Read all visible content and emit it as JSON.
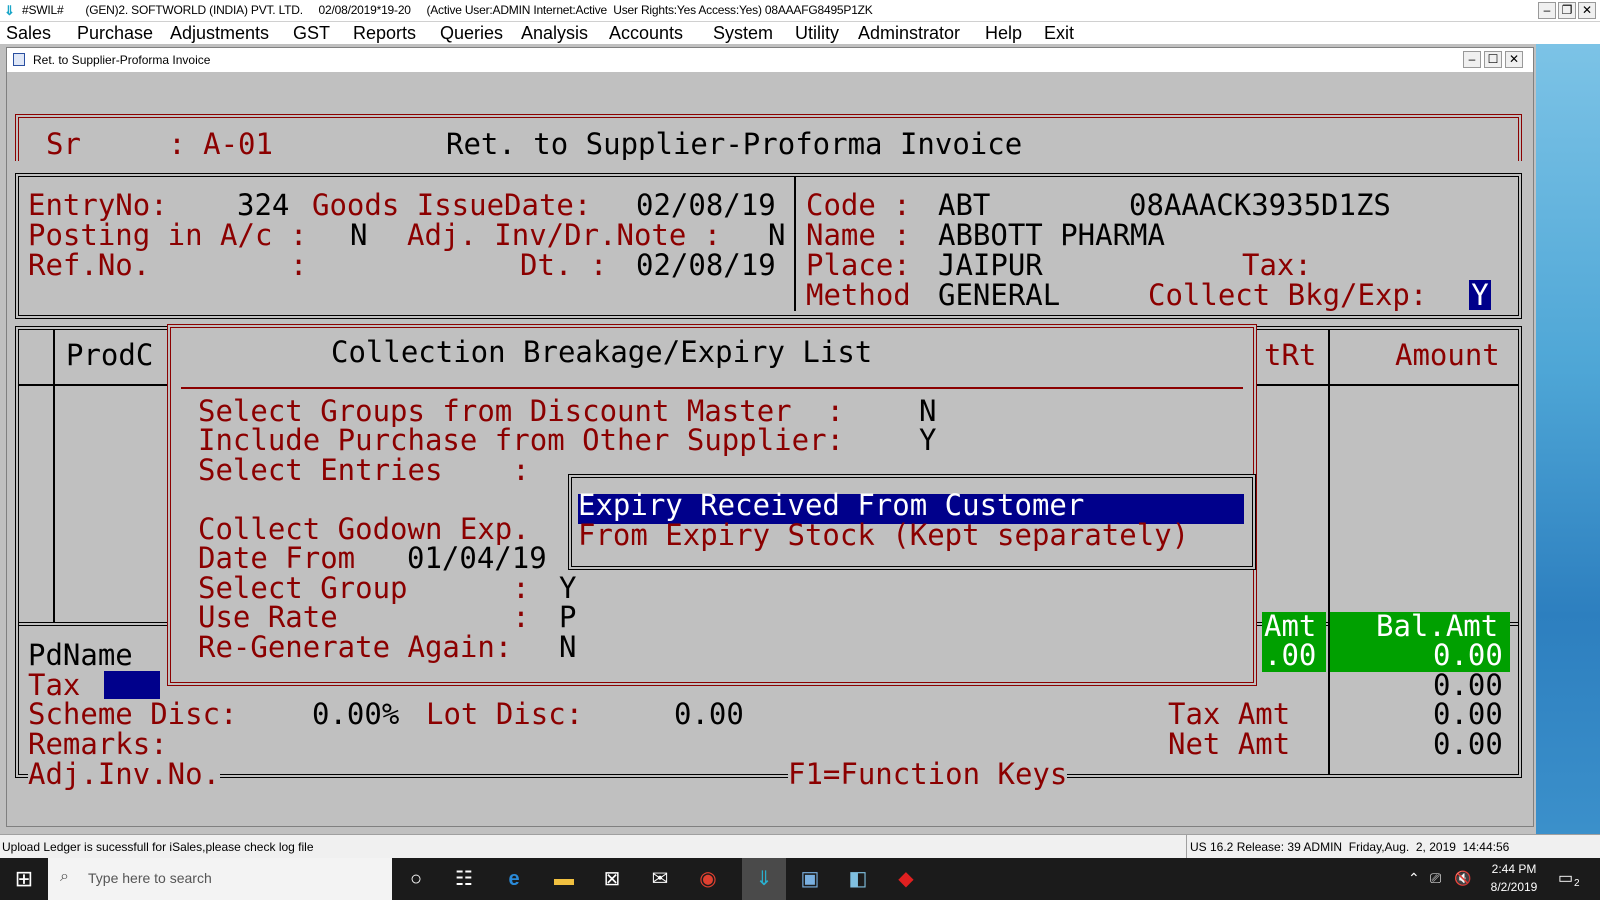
{
  "window": {
    "title": "#SWIL#       (GEN)2. SOFTWORLD (INDIA) PVT. LTD.     02/08/2019*19-20     (Active User:ADMIN Internet:Active  User Rights:Yes Access:Yes) 08AAAFG8495P1ZK",
    "min": "–",
    "restore": "❐",
    "close": "✕"
  },
  "menu": [
    "Sales",
    "Purchase",
    "Adjustments",
    "GST",
    "Reports",
    "Queries",
    "Analysis",
    "Accounts",
    "System",
    "Utility",
    "Adminstrator",
    "Help",
    "Exit"
  ],
  "child": {
    "title": "Ret. to Supplier-Proforma Invoice",
    "min": "–",
    "restore": "☐",
    "close": "✕"
  },
  "header": {
    "sr_label": "Sr     : A-01",
    "title": "Ret. to Supplier-Proforma Invoice"
  },
  "left": {
    "entry_label": "EntryNo:",
    "entry_no": "324",
    "goods_issue_label": "Goods IssueDate:",
    "goods_issue_date": "02/08/19",
    "posting_label": "Posting in A/c :",
    "posting_value": "N",
    "adj_label": "Adj. Inv/Dr.Note :",
    "adj_value": "N",
    "ref_label": "Ref.No.        :",
    "dt_label": "Dt. :",
    "dt_value": "02/08/19"
  },
  "right": {
    "code_label": "Code :",
    "code_value": "ABT",
    "gstin": "08AAACK3935D1ZS",
    "name_label": "Name :",
    "name_value": "ABBOTT PHARMA",
    "place_label": "Place:",
    "place_value": "JAIPUR",
    "tax_label": "Tax:",
    "method_label": "Method",
    "method_value": "GENERAL",
    "collect_label": "Collect Bkg/Exp:",
    "collect_value": "Y"
  },
  "grid": {
    "col_prod": "ProdC",
    "col_trt": "tRt",
    "col_amount": "Amount",
    "amt_label": "Amt",
    "amt_value": ".00",
    "bal_amt_label": "Bal.Amt",
    "bal_amt_value": "0.00"
  },
  "footer": {
    "pdname_label": "PdName",
    "tax_label": "Tax",
    "scheme_label": "Scheme Disc:",
    "scheme_value": "0.00%",
    "lot_label": "Lot Disc:",
    "lot_value": "0.00",
    "remarks_label": "Remarks:",
    "adjinv_label": "Adj.Inv.No.",
    "fkeys": "F1=Function Keys",
    "row1_value": "0.00",
    "tax_amt_label": "Tax Amt",
    "tax_amt_value": "0.00",
    "net_amt_label": "Net Amt",
    "net_amt_value": "0.00"
  },
  "popup": {
    "title": "Collection Breakage/Expiry List",
    "groups_label": "Select Groups from Discount Master  :",
    "groups_value": "N",
    "include_label": "Include Purchase from Other Supplier:",
    "include_value": "Y",
    "entries_label": "Select Entries    :",
    "godown_label": "Collect Godown Exp.",
    "date_from_label": "Date From",
    "date_from_value": "01/04/19",
    "select_group_label": "Select Group      :",
    "select_group_value": "Y",
    "use_rate_label": "Use Rate          :",
    "use_rate_value": "P",
    "regen_label": "Re-Generate Again:",
    "regen_value": "N",
    "options": [
      "Expiry Received From Customer",
      "From Expiry Stock (Kept separately)"
    ]
  },
  "status": {
    "left": "Upload Ledger is sucessfull for iSales,please check log file",
    "right": "US 16.2 Release: 39 ADMIN  Friday,Aug.  2, 2019  14:44:56"
  },
  "taskbar": {
    "search_placeholder": "Type here to search",
    "time": "2:44 PM",
    "date": "8/2/2019",
    "notif_count": "2"
  }
}
